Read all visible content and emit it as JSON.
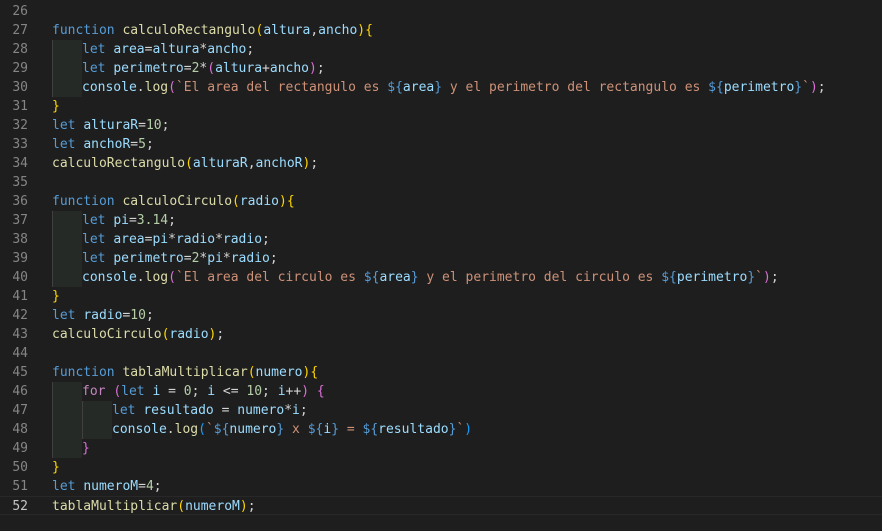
{
  "editor": {
    "language": "javascript",
    "active_line": 52,
    "top_fragment": [
      {
        "t": "                 ",
        "c": "op"
      },
      {
        "t": "`",
        "c": "str"
      }
    ],
    "lines": [
      {
        "n": "26",
        "guides": 0,
        "tokens": []
      },
      {
        "n": "27",
        "guides": 0,
        "tokens": [
          {
            "t": "function",
            "c": "kw"
          },
          {
            "t": " ",
            "c": "op"
          },
          {
            "t": "calculoRectangulo",
            "c": "fn"
          },
          {
            "t": "(",
            "c": "p1"
          },
          {
            "t": "altura",
            "c": "var"
          },
          {
            "t": ",",
            "c": "op"
          },
          {
            "t": "ancho",
            "c": "var"
          },
          {
            "t": ")",
            "c": "p1"
          },
          {
            "t": "{",
            "c": "p1"
          }
        ]
      },
      {
        "n": "28",
        "guides": 1,
        "tokens": [
          {
            "t": "let",
            "c": "kw"
          },
          {
            "t": " ",
            "c": "op"
          },
          {
            "t": "area",
            "c": "var"
          },
          {
            "t": "=",
            "c": "op"
          },
          {
            "t": "altura",
            "c": "var"
          },
          {
            "t": "*",
            "c": "op"
          },
          {
            "t": "ancho",
            "c": "var"
          },
          {
            "t": ";",
            "c": "op"
          }
        ]
      },
      {
        "n": "29",
        "guides": 1,
        "tokens": [
          {
            "t": "let",
            "c": "kw"
          },
          {
            "t": " ",
            "c": "op"
          },
          {
            "t": "perimetro",
            "c": "var"
          },
          {
            "t": "=",
            "c": "op"
          },
          {
            "t": "2",
            "c": "num"
          },
          {
            "t": "*",
            "c": "op"
          },
          {
            "t": "(",
            "c": "p2"
          },
          {
            "t": "altura",
            "c": "var"
          },
          {
            "t": "+",
            "c": "op"
          },
          {
            "t": "ancho",
            "c": "var"
          },
          {
            "t": ")",
            "c": "p2"
          },
          {
            "t": ";",
            "c": "op"
          }
        ]
      },
      {
        "n": "30",
        "guides": 1,
        "tokens": [
          {
            "t": "console",
            "c": "var"
          },
          {
            "t": ".",
            "c": "op"
          },
          {
            "t": "log",
            "c": "fn"
          },
          {
            "t": "(",
            "c": "p2"
          },
          {
            "t": "`El area del rectangulo es ",
            "c": "str"
          },
          {
            "t": "${",
            "c": "kw"
          },
          {
            "t": "area",
            "c": "var"
          },
          {
            "t": "}",
            "c": "kw"
          },
          {
            "t": " y el perimetro del rectangulo es ",
            "c": "str"
          },
          {
            "t": "${",
            "c": "kw"
          },
          {
            "t": "perimetro",
            "c": "var"
          },
          {
            "t": "}",
            "c": "kw"
          },
          {
            "t": "`",
            "c": "str"
          },
          {
            "t": ")",
            "c": "p2"
          },
          {
            "t": ";",
            "c": "op"
          }
        ]
      },
      {
        "n": "31",
        "guides": 0,
        "tokens": [
          {
            "t": "}",
            "c": "p1"
          }
        ]
      },
      {
        "n": "32",
        "guides": 0,
        "tokens": [
          {
            "t": "let",
            "c": "kw"
          },
          {
            "t": " ",
            "c": "op"
          },
          {
            "t": "alturaR",
            "c": "var"
          },
          {
            "t": "=",
            "c": "op"
          },
          {
            "t": "10",
            "c": "num"
          },
          {
            "t": ";",
            "c": "op"
          }
        ]
      },
      {
        "n": "33",
        "guides": 0,
        "tokens": [
          {
            "t": "let",
            "c": "kw"
          },
          {
            "t": " ",
            "c": "op"
          },
          {
            "t": "anchoR",
            "c": "var"
          },
          {
            "t": "=",
            "c": "op"
          },
          {
            "t": "5",
            "c": "num"
          },
          {
            "t": ";",
            "c": "op"
          }
        ]
      },
      {
        "n": "34",
        "guides": 0,
        "tokens": [
          {
            "t": "calculoRectangulo",
            "c": "fn"
          },
          {
            "t": "(",
            "c": "p1"
          },
          {
            "t": "alturaR",
            "c": "var"
          },
          {
            "t": ",",
            "c": "op"
          },
          {
            "t": "anchoR",
            "c": "var"
          },
          {
            "t": ")",
            "c": "p1"
          },
          {
            "t": ";",
            "c": "op"
          }
        ]
      },
      {
        "n": "35",
        "guides": 0,
        "tokens": []
      },
      {
        "n": "36",
        "guides": 0,
        "tokens": [
          {
            "t": "function",
            "c": "kw"
          },
          {
            "t": " ",
            "c": "op"
          },
          {
            "t": "calculoCirculo",
            "c": "fn"
          },
          {
            "t": "(",
            "c": "p1"
          },
          {
            "t": "radio",
            "c": "var"
          },
          {
            "t": ")",
            "c": "p1"
          },
          {
            "t": "{",
            "c": "p1"
          }
        ]
      },
      {
        "n": "37",
        "guides": 1,
        "tokens": [
          {
            "t": "let",
            "c": "kw"
          },
          {
            "t": " ",
            "c": "op"
          },
          {
            "t": "pi",
            "c": "var"
          },
          {
            "t": "=",
            "c": "op"
          },
          {
            "t": "3.14",
            "c": "num"
          },
          {
            "t": ";",
            "c": "op"
          }
        ]
      },
      {
        "n": "38",
        "guides": 1,
        "tokens": [
          {
            "t": "let",
            "c": "kw"
          },
          {
            "t": " ",
            "c": "op"
          },
          {
            "t": "area",
            "c": "var"
          },
          {
            "t": "=",
            "c": "op"
          },
          {
            "t": "pi",
            "c": "var"
          },
          {
            "t": "*",
            "c": "op"
          },
          {
            "t": "radio",
            "c": "var"
          },
          {
            "t": "*",
            "c": "op"
          },
          {
            "t": "radio",
            "c": "var"
          },
          {
            "t": ";",
            "c": "op"
          }
        ]
      },
      {
        "n": "39",
        "guides": 1,
        "tokens": [
          {
            "t": "let",
            "c": "kw"
          },
          {
            "t": " ",
            "c": "op"
          },
          {
            "t": "perimetro",
            "c": "var"
          },
          {
            "t": "=",
            "c": "op"
          },
          {
            "t": "2",
            "c": "num"
          },
          {
            "t": "*",
            "c": "op"
          },
          {
            "t": "pi",
            "c": "var"
          },
          {
            "t": "*",
            "c": "op"
          },
          {
            "t": "radio",
            "c": "var"
          },
          {
            "t": ";",
            "c": "op"
          }
        ]
      },
      {
        "n": "40",
        "guides": 1,
        "tokens": [
          {
            "t": "console",
            "c": "var"
          },
          {
            "t": ".",
            "c": "op"
          },
          {
            "t": "log",
            "c": "fn"
          },
          {
            "t": "(",
            "c": "p2"
          },
          {
            "t": "`El area del circulo es ",
            "c": "str"
          },
          {
            "t": "${",
            "c": "kw"
          },
          {
            "t": "area",
            "c": "var"
          },
          {
            "t": "}",
            "c": "kw"
          },
          {
            "t": " y el perimetro del circulo es ",
            "c": "str"
          },
          {
            "t": "${",
            "c": "kw"
          },
          {
            "t": "perimetro",
            "c": "var"
          },
          {
            "t": "}",
            "c": "kw"
          },
          {
            "t": "`",
            "c": "str"
          },
          {
            "t": ")",
            "c": "p2"
          },
          {
            "t": ";",
            "c": "op"
          }
        ]
      },
      {
        "n": "41",
        "guides": 0,
        "tokens": [
          {
            "t": "}",
            "c": "p1"
          }
        ]
      },
      {
        "n": "42",
        "guides": 0,
        "tokens": [
          {
            "t": "let",
            "c": "kw"
          },
          {
            "t": " ",
            "c": "op"
          },
          {
            "t": "radio",
            "c": "var"
          },
          {
            "t": "=",
            "c": "op"
          },
          {
            "t": "10",
            "c": "num"
          },
          {
            "t": ";",
            "c": "op"
          }
        ]
      },
      {
        "n": "43",
        "guides": 0,
        "tokens": [
          {
            "t": "calculoCirculo",
            "c": "fn"
          },
          {
            "t": "(",
            "c": "p1"
          },
          {
            "t": "radio",
            "c": "var"
          },
          {
            "t": ")",
            "c": "p1"
          },
          {
            "t": ";",
            "c": "op"
          }
        ]
      },
      {
        "n": "44",
        "guides": 0,
        "tokens": []
      },
      {
        "n": "45",
        "guides": 0,
        "tokens": [
          {
            "t": "function",
            "c": "kw"
          },
          {
            "t": " ",
            "c": "op"
          },
          {
            "t": "tablaMultiplicar",
            "c": "fn"
          },
          {
            "t": "(",
            "c": "p1"
          },
          {
            "t": "numero",
            "c": "var"
          },
          {
            "t": ")",
            "c": "p1"
          },
          {
            "t": "{",
            "c": "p1"
          }
        ]
      },
      {
        "n": "46",
        "guides": 1,
        "tokens": [
          {
            "t": "for",
            "c": "ctl"
          },
          {
            "t": " ",
            "c": "op"
          },
          {
            "t": "(",
            "c": "p2"
          },
          {
            "t": "let",
            "c": "kw"
          },
          {
            "t": " ",
            "c": "op"
          },
          {
            "t": "i",
            "c": "var"
          },
          {
            "t": " = ",
            "c": "op"
          },
          {
            "t": "0",
            "c": "num"
          },
          {
            "t": "; ",
            "c": "op"
          },
          {
            "t": "i",
            "c": "var"
          },
          {
            "t": " <= ",
            "c": "op"
          },
          {
            "t": "10",
            "c": "num"
          },
          {
            "t": "; ",
            "c": "op"
          },
          {
            "t": "i",
            "c": "var"
          },
          {
            "t": "++",
            "c": "op"
          },
          {
            "t": ")",
            "c": "p2"
          },
          {
            "t": " ",
            "c": "op"
          },
          {
            "t": "{",
            "c": "p2"
          }
        ]
      },
      {
        "n": "47",
        "guides": 2,
        "tokens": [
          {
            "t": "let",
            "c": "kw"
          },
          {
            "t": " ",
            "c": "op"
          },
          {
            "t": "resultado",
            "c": "var"
          },
          {
            "t": " = ",
            "c": "op"
          },
          {
            "t": "numero",
            "c": "var"
          },
          {
            "t": "*",
            "c": "op"
          },
          {
            "t": "i",
            "c": "var"
          },
          {
            "t": ";",
            "c": "op"
          }
        ]
      },
      {
        "n": "48",
        "guides": 2,
        "tokens": [
          {
            "t": "console",
            "c": "var"
          },
          {
            "t": ".",
            "c": "op"
          },
          {
            "t": "log",
            "c": "fn"
          },
          {
            "t": "(",
            "c": "p3"
          },
          {
            "t": "`",
            "c": "str"
          },
          {
            "t": "${",
            "c": "kw"
          },
          {
            "t": "numero",
            "c": "var"
          },
          {
            "t": "}",
            "c": "kw"
          },
          {
            "t": " x ",
            "c": "str"
          },
          {
            "t": "${",
            "c": "kw"
          },
          {
            "t": "i",
            "c": "var"
          },
          {
            "t": "}",
            "c": "kw"
          },
          {
            "t": " = ",
            "c": "str"
          },
          {
            "t": "${",
            "c": "kw"
          },
          {
            "t": "resultado",
            "c": "var"
          },
          {
            "t": "}",
            "c": "kw"
          },
          {
            "t": "`",
            "c": "str"
          },
          {
            "t": ")",
            "c": "p3"
          }
        ]
      },
      {
        "n": "49",
        "guides": 1,
        "tokens": [
          {
            "t": "}",
            "c": "p2"
          }
        ]
      },
      {
        "n": "50",
        "guides": 0,
        "tokens": [
          {
            "t": "}",
            "c": "p1"
          }
        ]
      },
      {
        "n": "51",
        "guides": 0,
        "tokens": [
          {
            "t": "let",
            "c": "kw"
          },
          {
            "t": " ",
            "c": "op"
          },
          {
            "t": "numeroM",
            "c": "var"
          },
          {
            "t": "=",
            "c": "op"
          },
          {
            "t": "4",
            "c": "num"
          },
          {
            "t": ";",
            "c": "op"
          }
        ]
      },
      {
        "n": "52",
        "guides": 0,
        "tokens": [
          {
            "t": "tablaMultiplicar",
            "c": "fn"
          },
          {
            "t": "(",
            "c": "p1"
          },
          {
            "t": "numeroM",
            "c": "var"
          },
          {
            "t": ")",
            "c": "p1"
          },
          {
            "t": ";",
            "c": "op"
          }
        ]
      }
    ]
  }
}
